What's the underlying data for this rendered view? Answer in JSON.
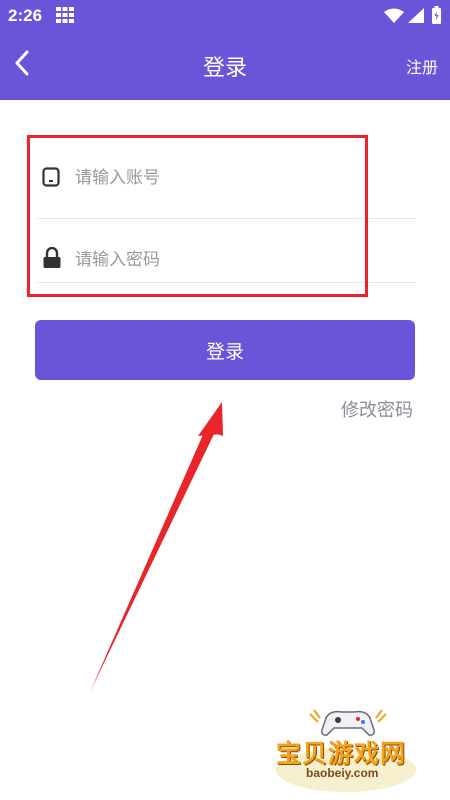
{
  "statusbar": {
    "time": "2:26"
  },
  "appbar": {
    "title": "登录",
    "register_label": "注册"
  },
  "form": {
    "account_placeholder": "请输入账号",
    "password_placeholder": "请输入密码",
    "login_label": "登录",
    "forgot_label": "修改密码"
  },
  "watermark": {
    "name": "宝贝游戏网",
    "url": "baobeiy.com"
  },
  "colors": {
    "brand": "#6a55d8",
    "highlight": "#e8262a",
    "link": "#8a8a99"
  },
  "icons": [
    "grid-icon",
    "wifi-icon",
    "signal-icon",
    "battery-icon",
    "back-icon",
    "phone-icon",
    "lock-icon",
    "gamepad-icon"
  ]
}
